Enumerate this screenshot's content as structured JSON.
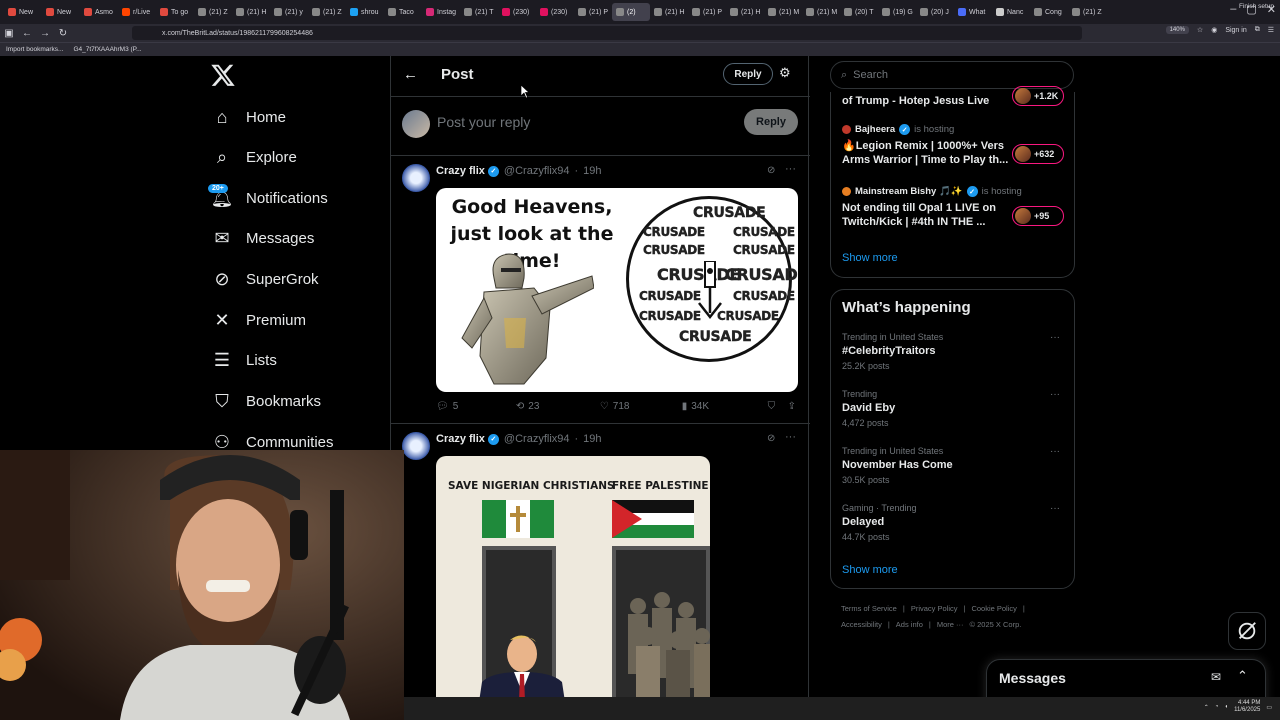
{
  "browser": {
    "tabs": [
      {
        "label": "New",
        "color": "#e04a3f"
      },
      {
        "label": "New",
        "color": "#e04a3f"
      },
      {
        "label": "Asmo",
        "color": "#e04a3f"
      },
      {
        "label": "r/Live",
        "color": "#ff4500"
      },
      {
        "label": "To go",
        "color": "#e04a3f"
      },
      {
        "label": "(21) Z",
        "color": "#888"
      },
      {
        "label": "(21) H",
        "color": "#888"
      },
      {
        "label": "(21) y",
        "color": "#888"
      },
      {
        "label": "(21) Z",
        "color": "#888"
      },
      {
        "label": "shrou",
        "color": "#1da1f2"
      },
      {
        "label": "Taco",
        "color": "#888"
      },
      {
        "label": "Instag",
        "color": "#d62976"
      },
      {
        "label": "(21) T",
        "color": "#888"
      },
      {
        "label": "(230)",
        "color": "#e0115f"
      },
      {
        "label": "(230)",
        "color": "#e0115f"
      },
      {
        "label": "(21) P",
        "color": "#888"
      },
      {
        "label": "(2)",
        "color": "#888",
        "active": true
      },
      {
        "label": "(21) H",
        "color": "#888"
      },
      {
        "label": "(21) P",
        "color": "#888"
      },
      {
        "label": "(21) H",
        "color": "#888"
      },
      {
        "label": "(21) M",
        "color": "#888"
      },
      {
        "label": "(21) M",
        "color": "#888"
      },
      {
        "label": "(20) T",
        "color": "#888"
      },
      {
        "label": "(19) G",
        "color": "#888"
      },
      {
        "label": "(20) J",
        "color": "#888"
      },
      {
        "label": "What",
        "color": "#4a6cf7"
      },
      {
        "label": "Nanc",
        "color": "#ccc"
      },
      {
        "label": "Cong",
        "color": "#888"
      },
      {
        "label": "(21) Z",
        "color": "#888"
      }
    ],
    "url": "x.com/TheBritLad/status/1986211799608254486",
    "zoom": "140%",
    "sign_in": "Sign in",
    "bookmarks": [
      "Import bookmarks...",
      "G4_7t7fXAAAhrM3 (P..."
    ],
    "finish_setup": "Finish setup"
  },
  "sidebar": {
    "notifications_badge": "20+",
    "items": [
      {
        "label": "Home",
        "icon": "home-icon"
      },
      {
        "label": "Explore",
        "icon": "search-icon"
      },
      {
        "label": "Notifications",
        "icon": "bell-icon"
      },
      {
        "label": "Messages",
        "icon": "mail-icon"
      },
      {
        "label": "SuperGrok",
        "icon": "grok-icon"
      },
      {
        "label": "Premium",
        "icon": "x-icon"
      },
      {
        "label": "Lists",
        "icon": "list-icon"
      },
      {
        "label": "Bookmarks",
        "icon": "bookmark-icon"
      },
      {
        "label": "Communities",
        "icon": "people-icon"
      }
    ]
  },
  "post": {
    "title": "Post",
    "reply_label": "Reply",
    "compose_placeholder": "Post your reply",
    "compose_reply": "Reply"
  },
  "tweets": [
    {
      "name": "Crazy flix",
      "handle": "@Crazyflix94",
      "time": "19h",
      "meme_caption": "Good Heavens, just look at the time!",
      "meme_word": "CRUSADE",
      "replies": "5",
      "reposts": "23",
      "likes": "718",
      "views": "34K"
    },
    {
      "name": "Crazy flix",
      "handle": "@Crazyflix94",
      "time": "19h",
      "left_heading": "SAVE NIGERIAN CHRISTIANS",
      "right_heading": "FREE PALESTINE"
    }
  ],
  "right": {
    "search_placeholder": "Search",
    "live": [
      {
        "title": "of Trump - Hotep Jesus Live",
        "count": "+1.2K"
      },
      {
        "host": "Bajheera",
        "hosting": "is hosting",
        "title": "🔥Legion Remix | 1000%+ Vers Arms Warrior | Time to Play th...",
        "count": "+632"
      },
      {
        "host": "Mainstream Bishy 🎵✨",
        "hosting": "is hosting",
        "title": "Not ending till Opal 1 LIVE on Twitch/Kick | #4th IN THE ...",
        "count": "+95"
      }
    ],
    "show_more": "Show more",
    "happening_title": "What’s happening",
    "trends": [
      {
        "context": "Trending in United States",
        "name": "#CelebrityTraitors",
        "count": "25.2K posts"
      },
      {
        "context": "Trending",
        "name": "David Eby",
        "count": "4,472 posts"
      },
      {
        "context": "Trending in United States",
        "name": "November Has Come",
        "count": "30.5K posts"
      },
      {
        "context": "Gaming · Trending",
        "name": "Delayed",
        "count": "44.7K posts"
      }
    ],
    "show_more_2": "Show more",
    "footer_line1": [
      "Terms of Service",
      "|",
      "Privacy Policy",
      "|",
      "Cookie Policy",
      "|"
    ],
    "footer_line2": [
      "Accessibility",
      "|",
      "Ads info",
      "|",
      "More ···",
      "© 2025 X Corp."
    ],
    "messages_drawer": "Messages"
  },
  "taskbar": {
    "time": "4:44 PM",
    "date": "11/6/2025"
  },
  "colors": {
    "accent": "#1d9bf0",
    "border": "#2f3336",
    "muted": "#71767b",
    "live_pink": "#f91880"
  }
}
